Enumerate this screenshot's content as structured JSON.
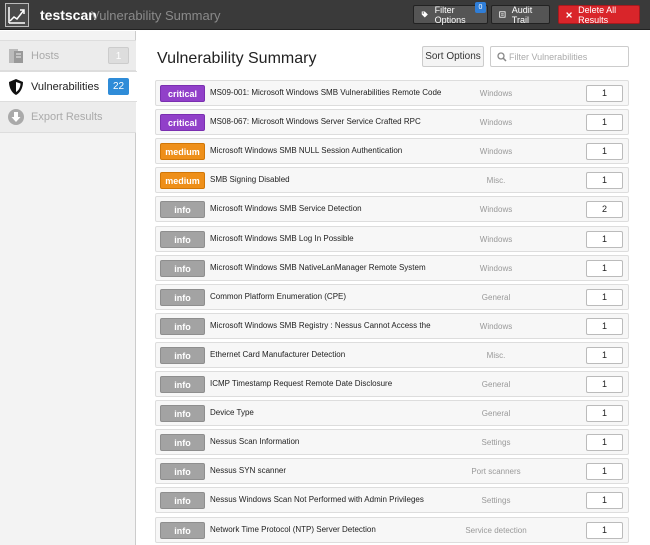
{
  "header": {
    "title": "testscan",
    "subtitle": "Vulnerability Summary",
    "filter_label": "Filter Options",
    "filter_badge": "0",
    "audit_label": "Audit Trail",
    "delete_label": "Delete All Results"
  },
  "sidebar": {
    "items": [
      {
        "label": "Hosts",
        "count": "1"
      },
      {
        "label": "Vulnerabilities",
        "count": "22"
      },
      {
        "label": "Export Results"
      }
    ]
  },
  "main": {
    "title": "Vulnerability Summary",
    "sort_label": "Sort Options",
    "filter_placeholder": "Filter Vulnerabilities"
  },
  "colors": {
    "critical": "#9140c9",
    "medium": "#ee8f19",
    "info": "#a3a3a3",
    "delete_button": "#d9252a",
    "badge_blue": "#2f8cd8"
  },
  "vulnerabilities": [
    {
      "severity": "critical",
      "name": "MS09-001: Microsoft Windows SMB Vulnerabilities Remote Code",
      "family": "Windows",
      "count": "1"
    },
    {
      "severity": "critical",
      "name": "MS08-067: Microsoft Windows Server Service Crafted RPC",
      "family": "Windows",
      "count": "1"
    },
    {
      "severity": "medium",
      "name": "Microsoft Windows SMB NULL Session Authentication",
      "family": "Windows",
      "count": "1"
    },
    {
      "severity": "medium",
      "name": "SMB Signing Disabled",
      "family": "Misc.",
      "count": "1"
    },
    {
      "severity": "info",
      "name": "Microsoft Windows SMB Service Detection",
      "family": "Windows",
      "count": "2"
    },
    {
      "severity": "info",
      "name": "Microsoft Windows SMB Log In Possible",
      "family": "Windows",
      "count": "1"
    },
    {
      "severity": "info",
      "name": "Microsoft Windows SMB NativeLanManager Remote System",
      "family": "Windows",
      "count": "1"
    },
    {
      "severity": "info",
      "name": "Common Platform Enumeration (CPE)",
      "family": "General",
      "count": "1"
    },
    {
      "severity": "info",
      "name": "Microsoft Windows SMB Registry : Nessus Cannot Access the",
      "family": "Windows",
      "count": "1"
    },
    {
      "severity": "info",
      "name": "Ethernet Card Manufacturer Detection",
      "family": "Misc.",
      "count": "1"
    },
    {
      "severity": "info",
      "name": "ICMP Timestamp Request Remote Date Disclosure",
      "family": "General",
      "count": "1"
    },
    {
      "severity": "info",
      "name": "Device Type",
      "family": "General",
      "count": "1"
    },
    {
      "severity": "info",
      "name": "Nessus Scan Information",
      "family": "Settings",
      "count": "1"
    },
    {
      "severity": "info",
      "name": "Nessus SYN scanner",
      "family": "Port scanners",
      "count": "1"
    },
    {
      "severity": "info",
      "name": "Nessus Windows Scan Not Performed with Admin Privileges",
      "family": "Settings",
      "count": "1"
    },
    {
      "severity": "info",
      "name": "Network Time Protocol (NTP) Server Detection",
      "family": "Service detection",
      "count": "1"
    }
  ]
}
